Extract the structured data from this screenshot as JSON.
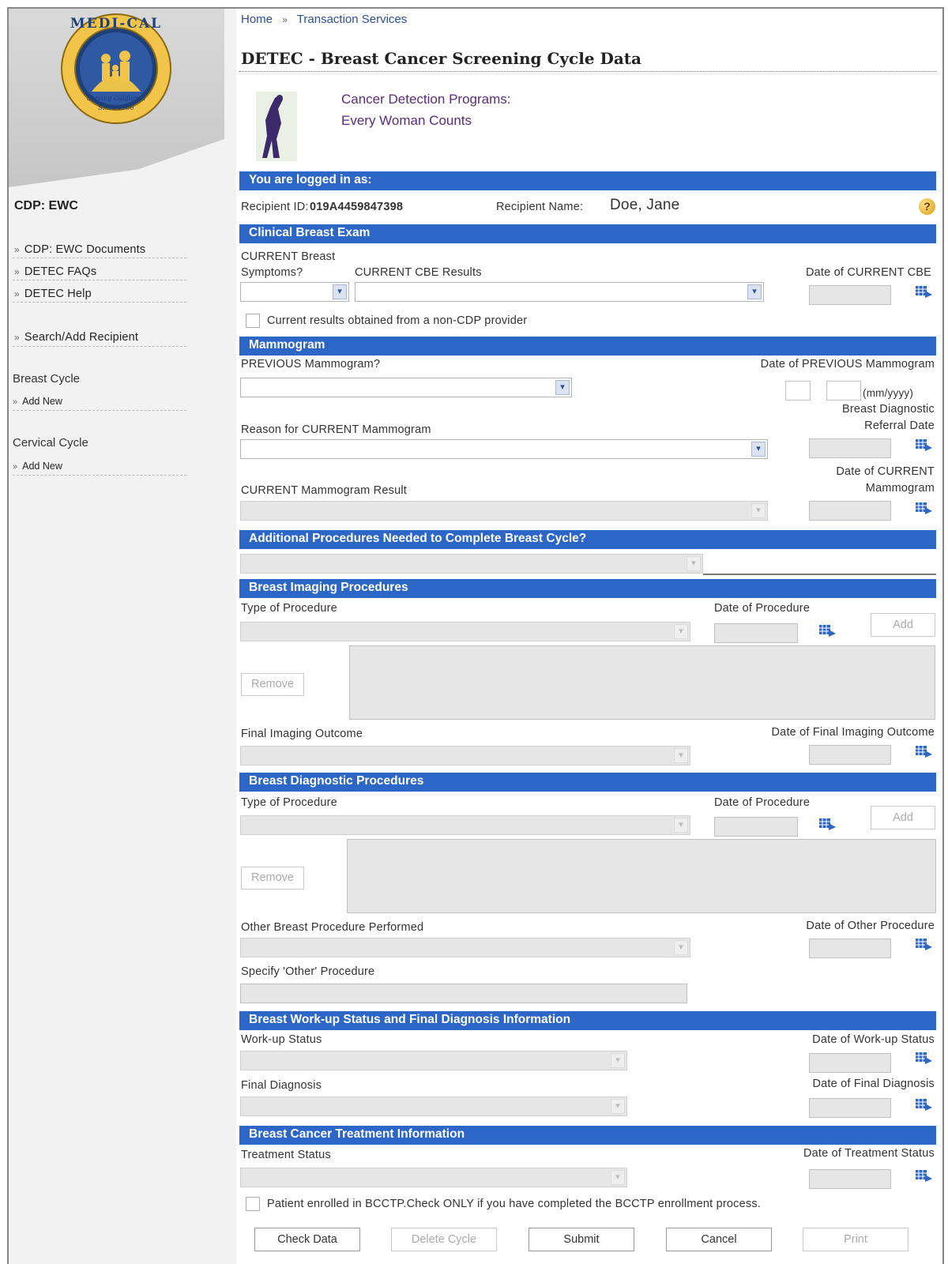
{
  "breadcrumb": {
    "home": "Home",
    "separator": "»",
    "current": "Transaction Services"
  },
  "page_title": "DETEC - Breast Cancer Screening Cycle Data",
  "program": {
    "line1": "Cancer Detection Programs:",
    "line2": "Every Woman Counts"
  },
  "seal": {
    "text_top": "MEDI-CAL",
    "text_bottom": "Serving California",
    "since": "Since 1966"
  },
  "sidebar": {
    "title": "CDP: EWC",
    "links": [
      "CDP: EWC Documents",
      "DETEC FAQs",
      "DETEC Help"
    ],
    "search": "Search/Add Recipient",
    "breast_cycle": {
      "title": "Breast Cycle",
      "add": "Add New"
    },
    "cervical_cycle": {
      "title": "Cervical Cycle",
      "add": "Add New"
    }
  },
  "logged_in": {
    "header": "You are logged in as:",
    "recipient_id_label": "Recipient ID:",
    "recipient_id": "019A4459847398",
    "recipient_name_label": "Recipient Name:",
    "recipient_name": "Doe, Jane",
    "help_icon": "question-mark-icon"
  },
  "cbe": {
    "header": "Clinical Breast Exam",
    "symptoms_label_1": "CURRENT Breast",
    "symptoms_label_2": "Symptoms?",
    "results_label": "CURRENT CBE Results",
    "date_label": "Date of CURRENT CBE",
    "non_cdp_label": "Current results obtained from a non-CDP provider"
  },
  "mammogram": {
    "header": "Mammogram",
    "previous_label": "PREVIOUS Mammogram?",
    "prev_date_label": "Date of PREVIOUS Mammogram",
    "prev_date_format": "(mm/yyyy)",
    "referral_label_1": "Breast Diagnostic",
    "referral_label_2": "Referral Date",
    "reason_label": "Reason for CURRENT Mammogram",
    "current_date_label_1": "Date of CURRENT",
    "current_date_label_2": "Mammogram",
    "result_label": "CURRENT Mammogram Result"
  },
  "additional": {
    "header": "Additional Procedures Needed to Complete Breast Cycle?"
  },
  "imaging": {
    "header": "Breast Imaging Procedures",
    "type_label": "Type of Procedure",
    "date_label": "Date of Procedure",
    "add": "Add",
    "remove": "Remove",
    "final_label": "Final Imaging Outcome",
    "final_date_label": "Date of Final Imaging Outcome"
  },
  "diagnostic": {
    "header": "Breast Diagnostic Procedures",
    "type_label": "Type of Procedure",
    "date_label": "Date of Procedure",
    "add": "Add",
    "remove": "Remove",
    "other_label": "Other Breast Procedure Performed",
    "other_date_label": "Date of Other Procedure",
    "specify_label": "Specify 'Other' Procedure"
  },
  "workup": {
    "header": "Breast Work-up Status and Final Diagnosis Information",
    "status_label": "Work-up Status",
    "status_date_label": "Date of Work-up Status",
    "diagnosis_label": "Final Diagnosis",
    "diagnosis_date_label": "Date of Final Diagnosis"
  },
  "treatment": {
    "header": "Breast Cancer Treatment Information",
    "status_label": "Treatment Status",
    "status_date_label": "Date of Treatment Status",
    "bcctp_label": "Patient enrolled in BCCTP.Check ONLY if you have completed the BCCTP enrollment process."
  },
  "actions": {
    "check": "Check Data",
    "delete": "Delete Cycle",
    "submit": "Submit",
    "cancel": "Cancel",
    "print": "Print"
  },
  "colors": {
    "header_bar": "#2c67c8",
    "title": "#222",
    "program_text": "#5c2a7e"
  }
}
